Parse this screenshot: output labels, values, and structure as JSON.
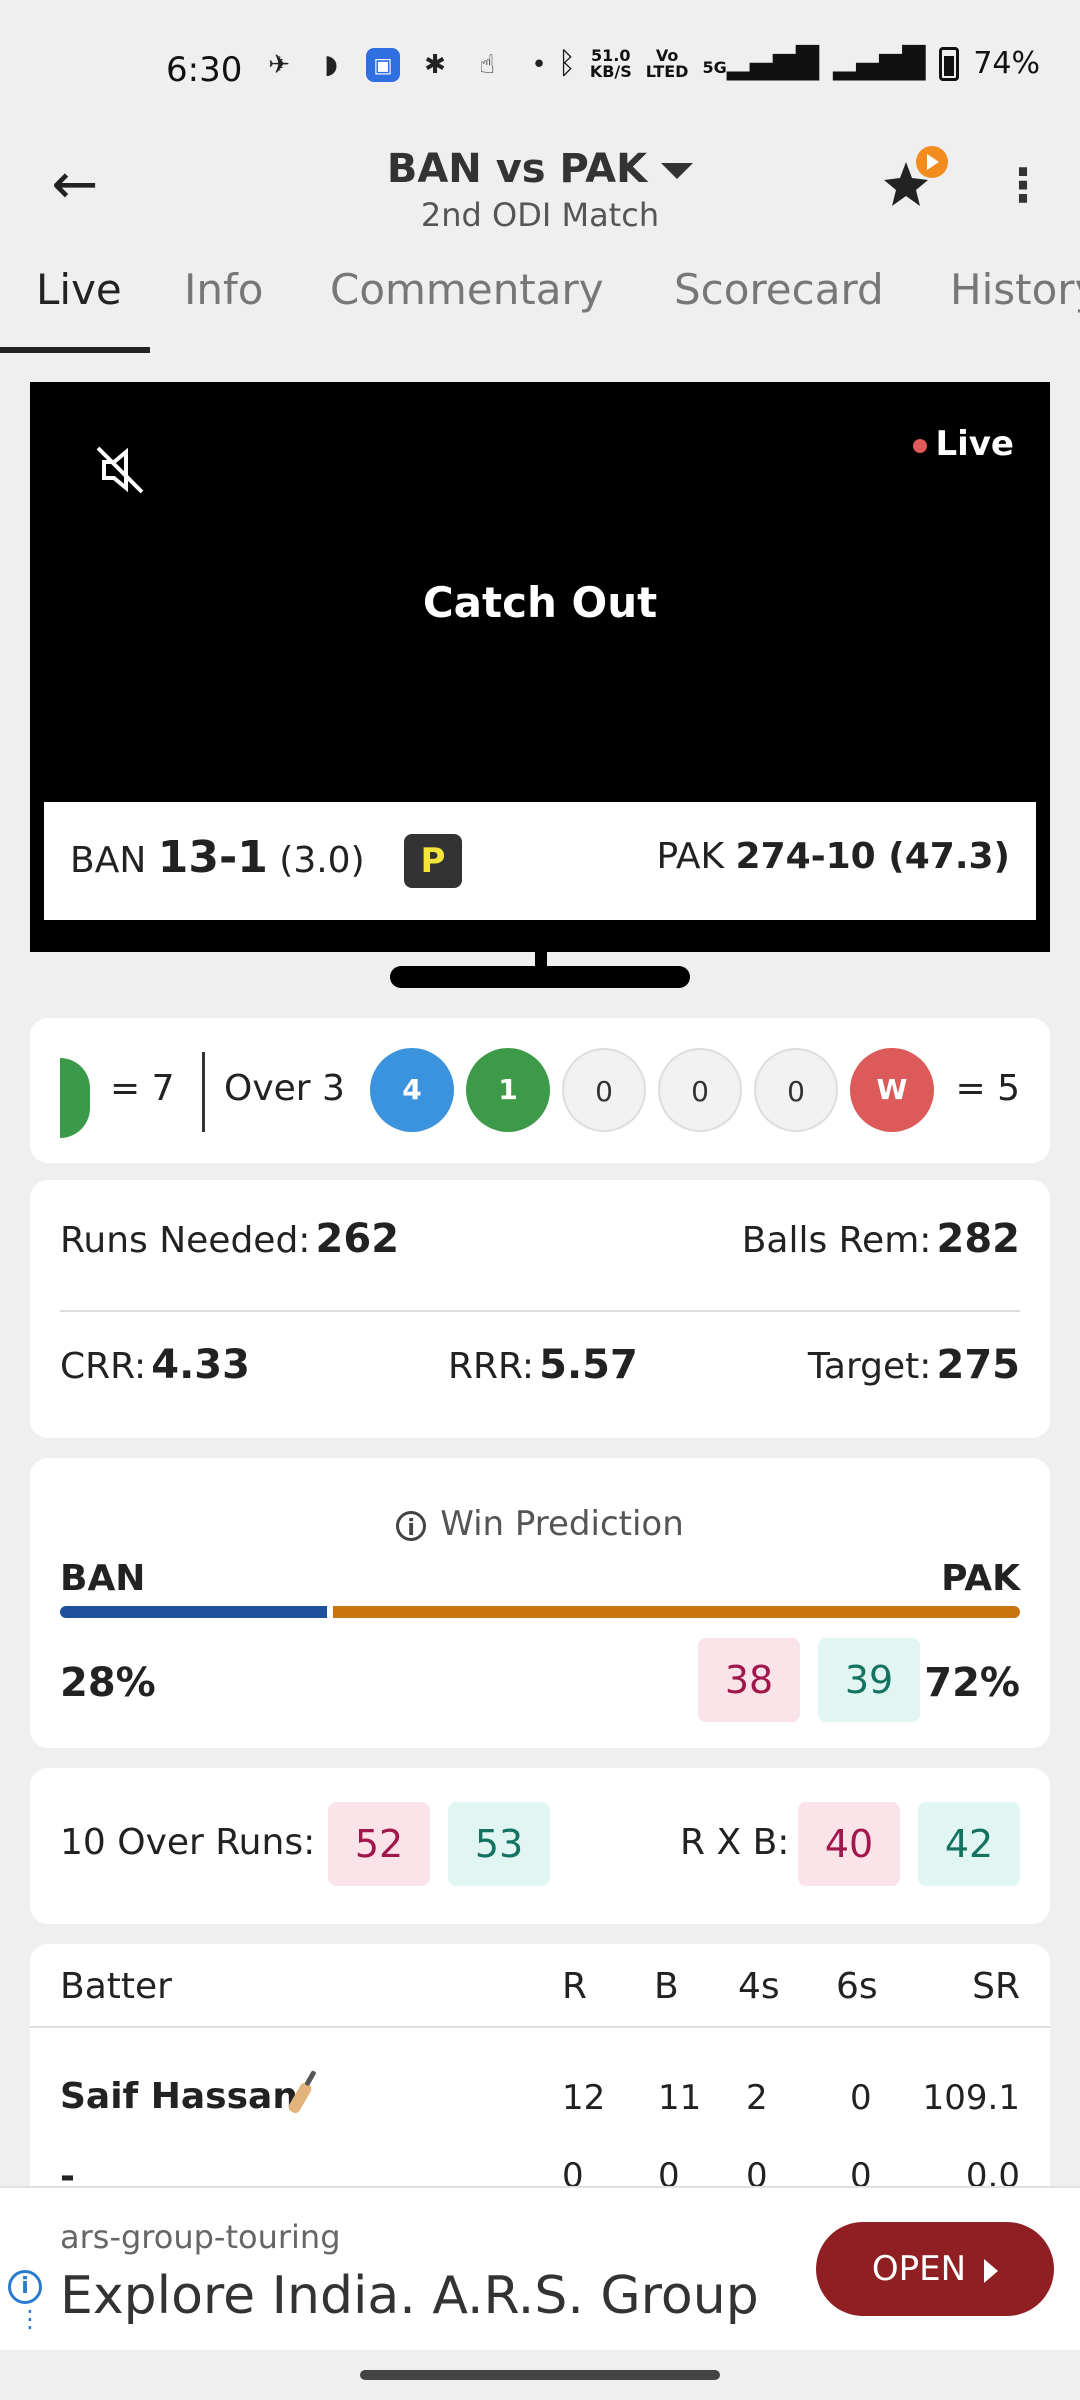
{
  "status_bar": {
    "time": "6:30",
    "speed_top": "51.0",
    "speed_bottom": "KB/S",
    "volte_top": "Vo",
    "volte_bottom": "LTED",
    "network": "5G",
    "battery": "74%"
  },
  "header": {
    "title": "BAN vs PAK",
    "subtitle": "2nd ODI Match"
  },
  "tabs": [
    "Live",
    "Info",
    "Commentary",
    "Scorecard",
    "History"
  ],
  "video": {
    "live_label": "Live",
    "event": "Catch Out",
    "team_a": "BAN",
    "team_a_score": "13-1",
    "team_a_overs": "(3.0)",
    "powerplay": "P",
    "team_b": "PAK",
    "team_b_score": "274-10 (47.3)"
  },
  "over": {
    "prev_total": "= 7",
    "label": "Over 3",
    "balls": [
      "4",
      "1",
      "0",
      "0",
      "0",
      "W"
    ],
    "total": "= 5"
  },
  "stats": {
    "runs_needed_label": "Runs Needed:",
    "runs_needed": "262",
    "balls_rem_label": "Balls Rem:",
    "balls_rem": "282",
    "crr_label": "CRR:",
    "crr": "4.33",
    "rrr_label": "RRR:",
    "rrr": "5.57",
    "target_label": "Target:",
    "target": "275"
  },
  "prediction": {
    "title": "Win Prediction",
    "team_a": "BAN",
    "team_b": "PAK",
    "team_a_pct": "28%",
    "team_b_pct": "72%",
    "team_a_share": 0.28,
    "odds_1": "38",
    "odds_2": "39",
    "colors": {
      "team_a": "#1f4e9c",
      "team_b": "#c9730f"
    }
  },
  "runs": {
    "ten_over_label": "10 Over Runs:",
    "ten_over_1": "52",
    "ten_over_2": "53",
    "rxb_label": "R X B:",
    "rxb_1": "40",
    "rxb_2": "42"
  },
  "batters": {
    "headers": [
      "Batter",
      "R",
      "B",
      "4s",
      "6s",
      "SR"
    ],
    "rows": [
      {
        "name": "Saif Hassan",
        "r": "12",
        "b": "11",
        "fours": "2",
        "sixes": "0",
        "sr": "109.1"
      },
      {
        "name": "-",
        "r": "0",
        "b": "0",
        "fours": "0",
        "sixes": "0",
        "sr": "0.0"
      }
    ]
  },
  "ad": {
    "source": "ars-group-touring",
    "title": "Explore India. A.R.S. Group",
    "cta": "OPEN"
  }
}
